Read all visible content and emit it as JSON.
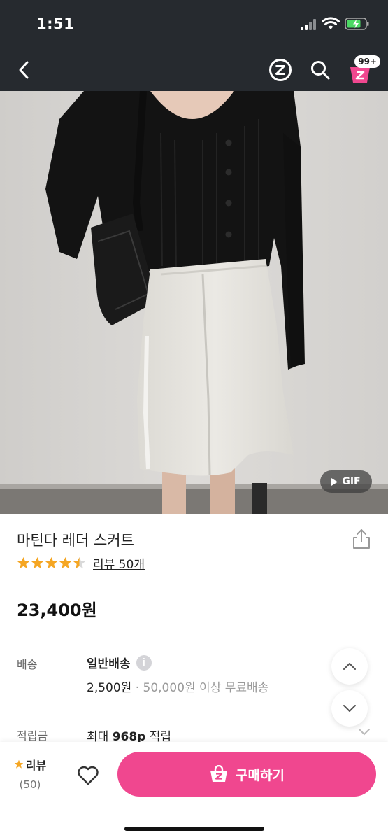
{
  "status_bar": {
    "time": "1:51"
  },
  "nav": {
    "cart_badge": "99+"
  },
  "image": {
    "gif_label": "GIF"
  },
  "product": {
    "title": "마틴다 레더 스커트",
    "rating": 4.5,
    "review_link": "리뷰 50개",
    "price": "23,400원"
  },
  "shipping": {
    "label": "배송",
    "type": "일반배송",
    "info_icon": "i",
    "fee": "2,500원",
    "free_condition": " · 50,000원 이상 무료배송"
  },
  "points": {
    "label": "적립금",
    "prefix": "최대 ",
    "amount": "968p",
    "suffix": " 적립"
  },
  "bottom_bar": {
    "review_label": "리뷰",
    "review_count": "(50)",
    "buy_label": "구매하기"
  },
  "colors": {
    "header_bg": "#262a2f",
    "brand_pink": "#f0478f",
    "star": "#f5a623"
  }
}
